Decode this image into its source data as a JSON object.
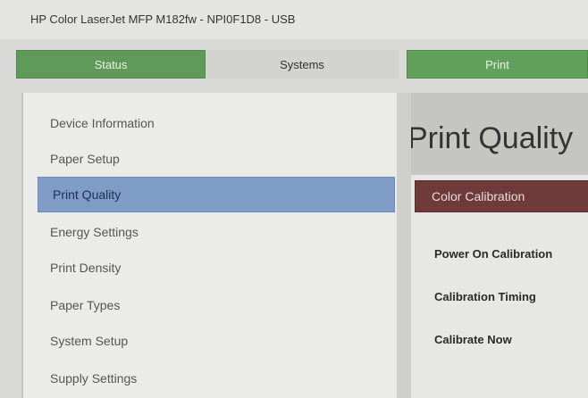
{
  "window": {
    "title": "HP Color LaserJet MFP M182fw - NPI0F1D8 - USB"
  },
  "tabs": [
    {
      "label": "Status"
    },
    {
      "label": "Systems"
    },
    {
      "label": "Print"
    }
  ],
  "sidebar": {
    "items": [
      {
        "label": "Device Information"
      },
      {
        "label": "Paper Setup"
      },
      {
        "label": "Print Quality"
      },
      {
        "label": "Energy Settings"
      },
      {
        "label": "Print Density"
      },
      {
        "label": "Paper Types"
      },
      {
        "label": "System Setup"
      },
      {
        "label": "Supply Settings"
      }
    ],
    "selected": "Print Quality"
  },
  "main": {
    "title": "Print Quality",
    "calibration_button": "Color Calibration",
    "fields": [
      {
        "label": "Power On Calibration"
      },
      {
        "label": "Calibration Timing"
      },
      {
        "label": "Calibrate Now"
      }
    ]
  },
  "colors": {
    "tab_green": "#5f9a58",
    "selected_blue": "#7e9cc6",
    "calibration_red": "#6e3a3a"
  }
}
